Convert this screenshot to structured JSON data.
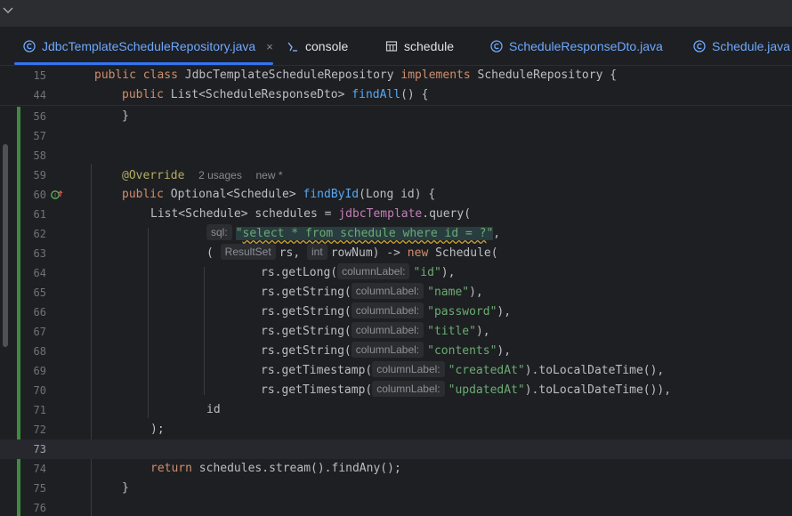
{
  "tabs": [
    {
      "label": "JdbcTemplateScheduleRepository.java",
      "icon": "java-class-icon",
      "active": true,
      "close": "×"
    },
    {
      "label": "console",
      "icon": "console-icon"
    },
    {
      "label": "schedule",
      "icon": "table-icon"
    },
    {
      "label": "ScheduleResponseDto.java",
      "icon": "java-class-icon"
    },
    {
      "label": "Schedule.java",
      "icon": "java-class-icon"
    }
  ],
  "editor": {
    "line_numbers": [
      "15",
      "44",
      "56",
      "57",
      "58",
      "59",
      "60",
      "61",
      "62",
      "63",
      "64",
      "65",
      "66",
      "67",
      "68",
      "69",
      "70",
      "71",
      "72",
      "73",
      "74",
      "75",
      "76"
    ],
    "sticky": {
      "l15": {
        "kw1": "public",
        "kw2": "class",
        "name": "JdbcTemplateScheduleRepository",
        "kw3": "implements",
        "iface": "ScheduleRepository {"
      },
      "l44": {
        "kw1": "public",
        "type": "List<ScheduleResponseDto>",
        "fn": "findAll",
        "rest": "() {"
      }
    },
    "l56": "}",
    "l59": {
      "annotation": "@Override",
      "usages": "2 usages",
      "new": "new *"
    },
    "l60": {
      "kw": "public",
      "type": "Optional<Schedule>",
      "fn": "findById",
      "rest": "(Long id) {"
    },
    "l61": {
      "type": "List<Schedule> schedules =",
      "field": "jdbcTemplate",
      "rest": ".query("
    },
    "l62": {
      "hint": "sql:",
      "q_open": "\"",
      "sql": "select * from schedule where id = ?",
      "q_close": "\"",
      "rest": ","
    },
    "l63": {
      "open": "(",
      "hint1": "ResultSet",
      "rs": "rs,",
      "hint2": "int",
      "rest": "rowNum) ->",
      "kw": "new",
      "rest2": "Schedule("
    },
    "mappings": [
      {
        "call": "rs.getLong(",
        "hint": "columnLabel:",
        "arg": "\"id\"",
        "rest": "),"
      },
      {
        "call": "rs.getString(",
        "hint": "columnLabel:",
        "arg": "\"name\"",
        "rest": "),"
      },
      {
        "call": "rs.getString(",
        "hint": "columnLabel:",
        "arg": "\"password\"",
        "rest": "),"
      },
      {
        "call": "rs.getString(",
        "hint": "columnLabel:",
        "arg": "\"title\"",
        "rest": "),"
      },
      {
        "call": "rs.getString(",
        "hint": "columnLabel:",
        "arg": "\"contents\"",
        "rest": "),"
      },
      {
        "call": "rs.getTimestamp(",
        "hint": "columnLabel:",
        "arg": "\"createdAt\"",
        "rest": ").toLocalDateTime(),"
      },
      {
        "call": "rs.getTimestamp(",
        "hint": "columnLabel:",
        "arg": "\"updatedAt\"",
        "rest": ").toLocalDateTime()),"
      }
    ],
    "l71": "id",
    "l72": ");",
    "l74": {
      "kw": "return",
      "rest": "schedules.stream().findAny();"
    },
    "l75": "}"
  },
  "colors": {
    "keyword": "#cf8e6d",
    "function": "#56a8f5",
    "string": "#6aab73",
    "annotation": "#b3ae60",
    "field": "#c77dbb",
    "text": "#bcbec4",
    "change_marker": "#3d8c40",
    "accent": "#3574f0"
  }
}
